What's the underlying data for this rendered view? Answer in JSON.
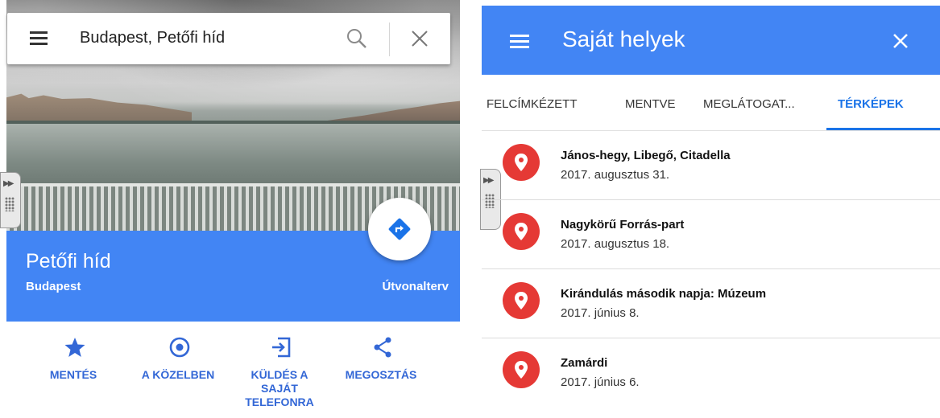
{
  "left_panel": {
    "search": {
      "query": "Budapest, Petőfi híd"
    },
    "place": {
      "name": "Petőfi híd",
      "city": "Budapest",
      "directions_label": "Útvonalterv"
    },
    "actions": [
      {
        "label": "MENTÉS",
        "icon": "star-icon"
      },
      {
        "label": "A KÖZELBEN",
        "icon": "nearby-icon"
      },
      {
        "label": "KÜLDÉS A SAJÁT TELEFONRA",
        "icon": "send-to-phone-icon"
      },
      {
        "label": "MEGOSZTÁS",
        "icon": "share-icon"
      }
    ]
  },
  "right_panel": {
    "title": "Saját helyek",
    "tabs": [
      {
        "label": "FELCÍMKÉZETT",
        "active": false
      },
      {
        "label": "MENTVE",
        "active": false
      },
      {
        "label": "MEGLÁTOGAT...",
        "active": false
      },
      {
        "label": "TÉRKÉPEK",
        "active": true
      }
    ],
    "maps": [
      {
        "title": "János-hegy, Libegő, Citadella",
        "date": "2017. augusztus 31."
      },
      {
        "title": "Nagykörű Forrás-part",
        "date": "2017. augusztus 18."
      },
      {
        "title": "Kirándulás második napja: Múzeum",
        "date": "2017. június 8."
      },
      {
        "title": "Zamárdi",
        "date": "2017. június 6."
      }
    ]
  },
  "colors": {
    "primary_blue": "#4285f4",
    "link_blue": "#3367d6",
    "pin_red": "#e53935",
    "tab_active": "#1a73e8"
  }
}
